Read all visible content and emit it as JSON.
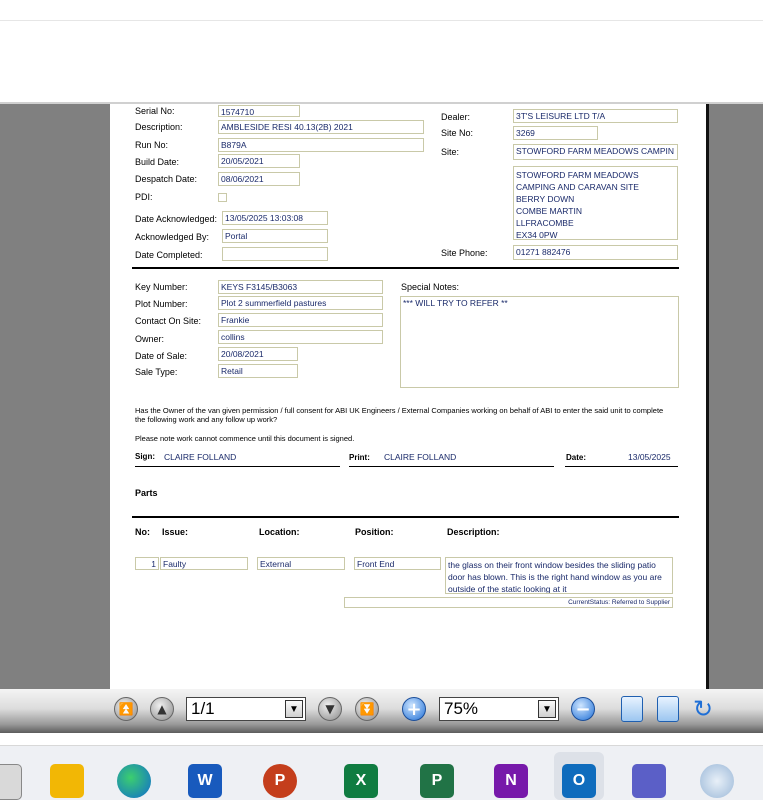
{
  "document": {
    "labels": {
      "serial_no": "Serial No:",
      "description": "Description:",
      "run_no": "Run No:",
      "build_date": "Build Date:",
      "despatch_date": "Despatch Date:",
      "pdi": "PDI:",
      "date_acknowledged": "Date Acknowledged:",
      "acknowledged_by": "Acknowledged By:",
      "date_completed": "Date Completed:",
      "dealer": "Dealer:",
      "site_no": "Site No:",
      "site": "Site:",
      "site_phone": "Site Phone:",
      "key_number": "Key Number:",
      "plot_number": "Plot Number:",
      "contact_on_site": "Contact On Site:",
      "owner": "Owner:",
      "date_of_sale": "Date of Sale:",
      "sale_type": "Sale Type:",
      "special_notes": "Special Notes:",
      "sign": "Sign:",
      "print": "Print:",
      "date": "Date:",
      "parts": "Parts",
      "col_no": "No:",
      "col_issue": "Issue:",
      "col_location": "Location:",
      "col_position": "Position:",
      "col_description": "Description:"
    },
    "values": {
      "serial_no": "1574710",
      "description": "AMBLESIDE RESI 40.13(2B) 2021",
      "run_no": "B879A",
      "build_date": "20/05/2021",
      "despatch_date": "08/06/2021",
      "date_acknowledged": "13/05/2025 13:03:08",
      "acknowledged_by": "Portal",
      "date_completed": "",
      "dealer": "3T'S LEISURE LTD T/A",
      "site_no": "3269",
      "site": "STOWFORD FARM MEADOWS CAMPIN",
      "address_lines": [
        "STOWFORD FARM MEADOWS",
        "CAMPING AND CARAVAN SITE",
        "BERRY DOWN",
        "COMBE MARTIN",
        "LLFRACOMBE",
        "EX34 0PW"
      ],
      "site_phone": "01271 882476",
      "key_number": "KEYS  F3145/B3063",
      "plot_number": "Plot 2 summerfield pastures",
      "contact_on_site": "Frankie",
      "owner": "collins",
      "date_of_sale": "20/08/2021",
      "sale_type": "Retail",
      "special_notes": "*** WILL TRY TO REFER **",
      "sign": "CLAIRE FOLLAND",
      "print": "CLAIRE FOLLAND",
      "date": "13/05/2025"
    },
    "consent_text": "Has the Owner of the van given permission / full consent for ABI UK Engineers / External Companies working on behalf of ABI to enter the said unit to complete the following work and any follow up work?",
    "note_text": "Please note work cannot commence until this document is signed.",
    "part_row": {
      "no": "1",
      "issue": "Faulty",
      "location": "External",
      "position": "Front End",
      "description": "the glass on their front window besides the sliding patio door has blown. This is the right hand window as you are outside of the static looking at it"
    },
    "current_status": "CurrentStatus: Referred to Supplier"
  },
  "toolbar": {
    "page_value": "1/1",
    "zoom_value": "75%"
  },
  "taskbar": {
    "word": "W",
    "powerpoint": "P",
    "excel": "X",
    "project": "P",
    "onenote": "N",
    "outlook": "O"
  },
  "colors": {
    "viewer_bg": "#808080",
    "field_text": "#1a2a6a",
    "accent_blue": "#1f6fd6"
  }
}
